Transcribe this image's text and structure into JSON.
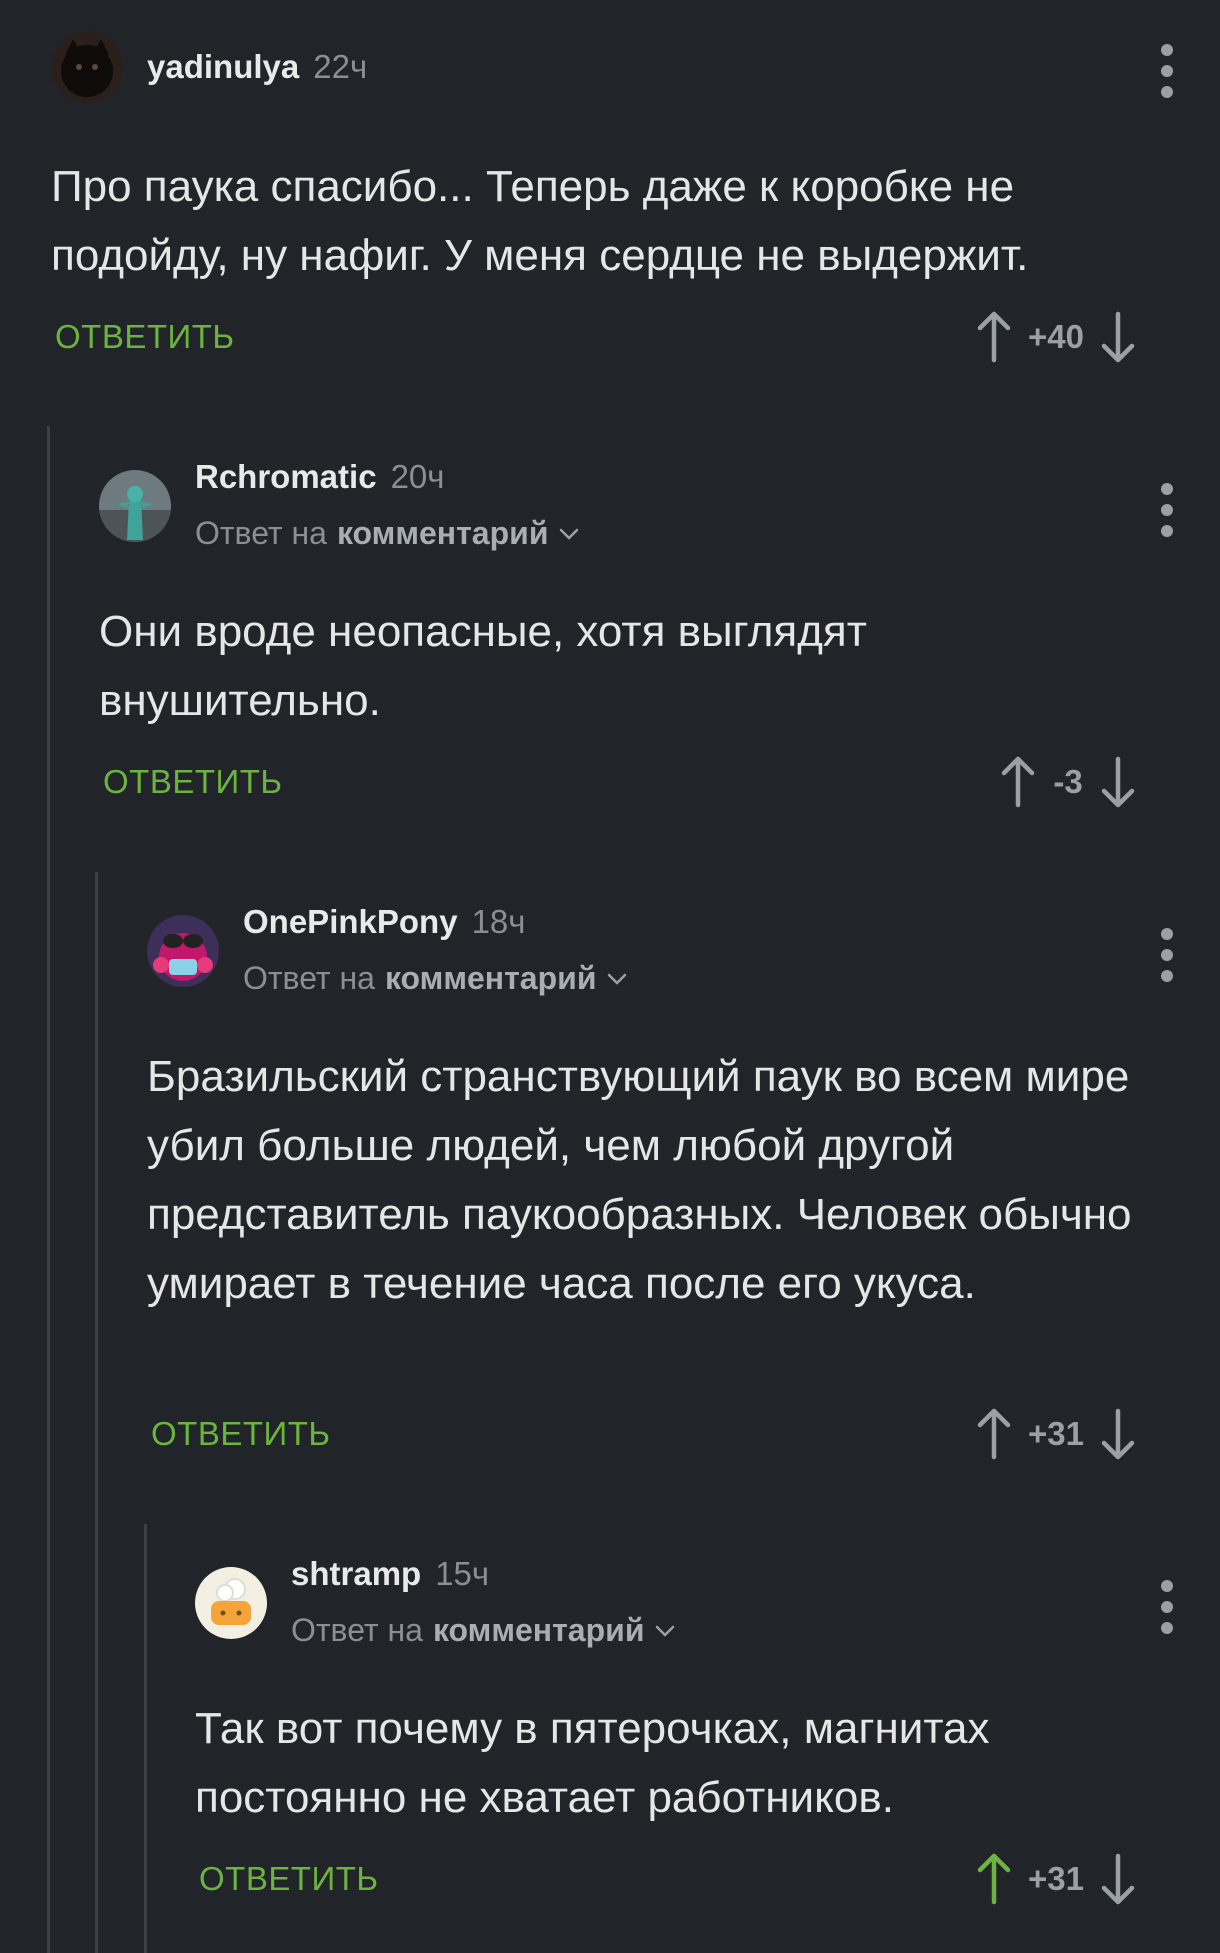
{
  "reply_label": "ОТВЕТИТЬ",
  "reply_to_prefix": "Ответ на",
  "reply_to_link": "комментарий",
  "colors": {
    "accent": "#6db33f",
    "background": "#212529",
    "muted": "#8a8f94"
  },
  "comments": [
    {
      "author": "yadinulya",
      "time": "22ч",
      "text": "Про паука спасибо... Теперь даже к коробке не подойду, ну нафиг. У меня сердце не выдержит.",
      "score": "+40",
      "upvoted": false,
      "has_reply_to": false
    },
    {
      "author": "Rchromatic",
      "time": "20ч",
      "text": "Они вроде неопасные, хотя выглядят внушительно.",
      "score": "-3",
      "upvoted": false,
      "has_reply_to": true
    },
    {
      "author": "OnePinkPony",
      "time": "18ч",
      "text": "Бразильский странствующий паук во всем мире убил больше людей, чем любой другой представитель паукообразных. Человек обычно умирает в течение часа после его укуса.",
      "score": "+31",
      "upvoted": false,
      "has_reply_to": true
    },
    {
      "author": "shtramp",
      "time": "15ч",
      "text": "Так вот почему в пятерочках, магнитах постоянно не хватает работников.",
      "score": "+31",
      "upvoted": true,
      "has_reply_to": true
    }
  ]
}
